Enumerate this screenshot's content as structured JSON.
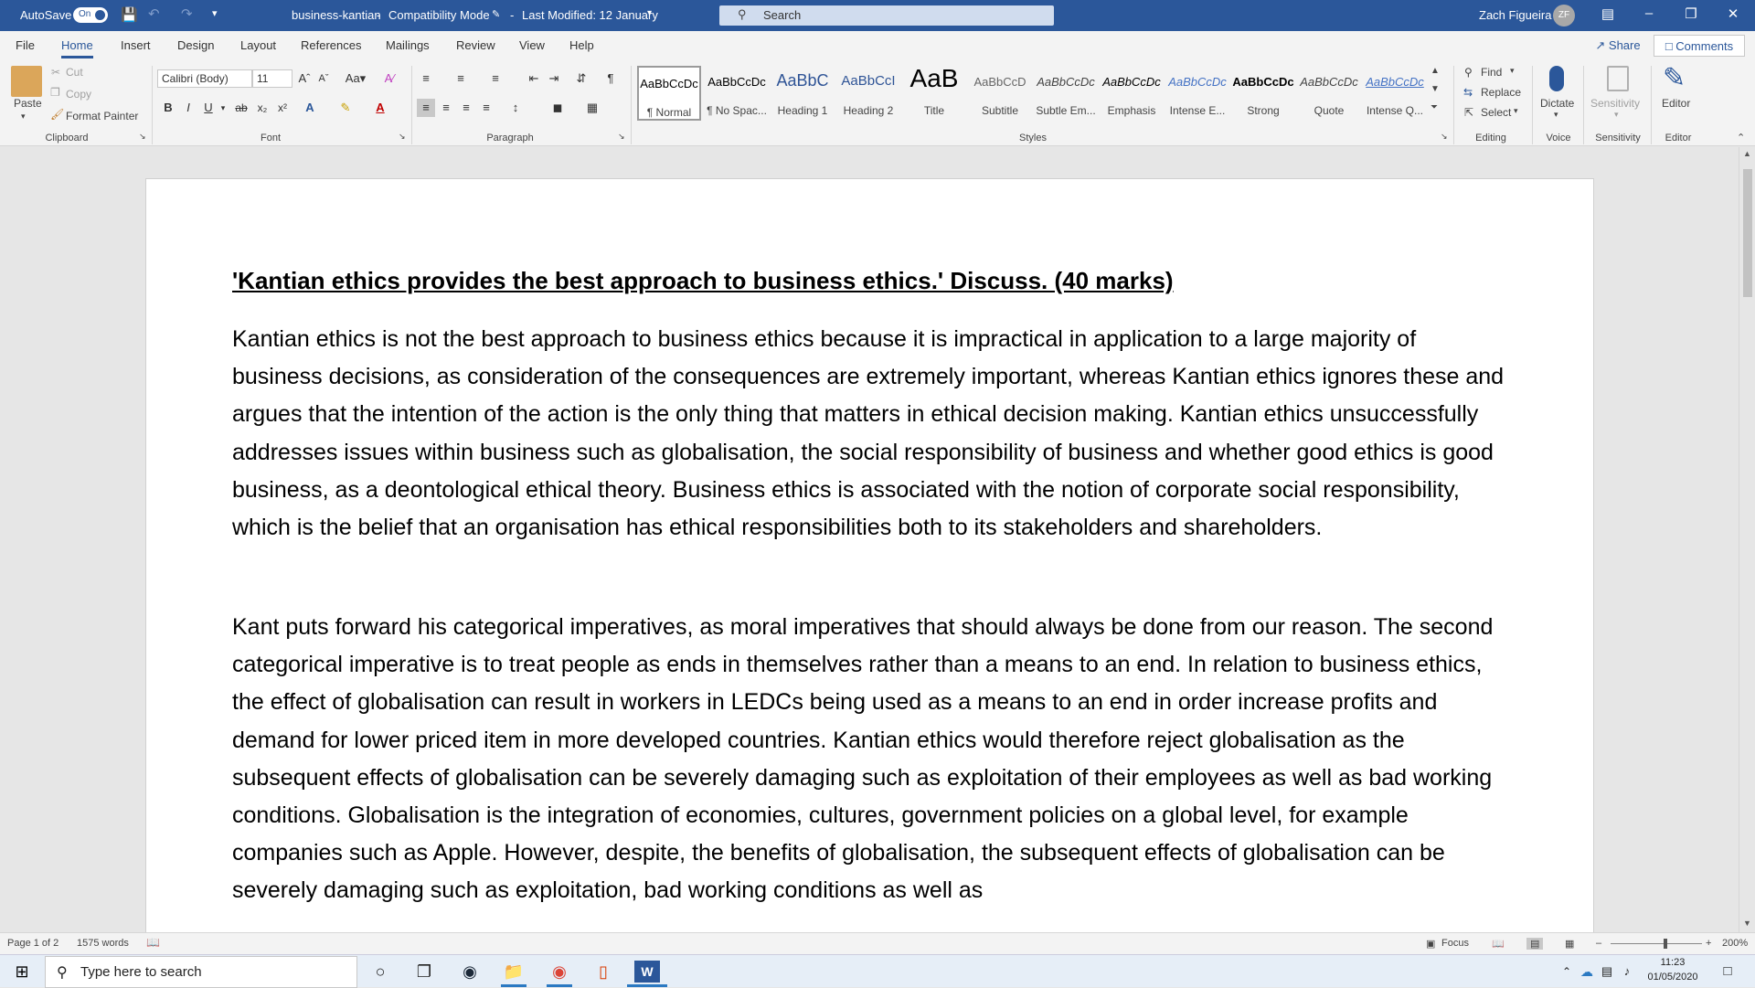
{
  "titlebar": {
    "autosave_label": "AutoSave",
    "autosave_state": "On",
    "doc_name": "business-kantian",
    "separator": "-",
    "mode": "Compatibility Mode",
    "separator2": "-",
    "last_modified": "Last Modified: 12 January",
    "search_placeholder": "Search",
    "user_name": "Zach Figueira",
    "user_initials": "ZF"
  },
  "tabs": [
    "File",
    "Home",
    "Insert",
    "Design",
    "Layout",
    "References",
    "Mailings",
    "Review",
    "View",
    "Help"
  ],
  "share_label": "Share",
  "comments_label": "Comments",
  "clipboard": {
    "paste": "Paste",
    "cut": "Cut",
    "copy": "Copy",
    "format_painter": "Format Painter",
    "group": "Clipboard"
  },
  "font": {
    "name": "Calibri (Body)",
    "size": "11",
    "group": "Font"
  },
  "paragraph": {
    "group": "Paragraph"
  },
  "styles": {
    "group": "Styles",
    "items": [
      {
        "preview": "AaBbCcDc",
        "name": "¶ Normal"
      },
      {
        "preview": "AaBbCcDc",
        "name": "¶ No Spac..."
      },
      {
        "preview": "AaBbC",
        "name": "Heading 1"
      },
      {
        "preview": "AaBbCcI",
        "name": "Heading 2"
      },
      {
        "preview": "AaB",
        "name": "Title"
      },
      {
        "preview": "AaBbCcD",
        "name": "Subtitle"
      },
      {
        "preview": "AaBbCcDc",
        "name": "Subtle Em..."
      },
      {
        "preview": "AaBbCcDc",
        "name": "Emphasis"
      },
      {
        "preview": "AaBbCcDc",
        "name": "Intense E..."
      },
      {
        "preview": "AaBbCcDc",
        "name": "Strong"
      },
      {
        "preview": "AaBbCcDc",
        "name": "Quote"
      },
      {
        "preview": "AaBbCcDc",
        "name": "Intense Q..."
      }
    ]
  },
  "editing": {
    "find": "Find",
    "replace": "Replace",
    "select": "Select",
    "group": "Editing"
  },
  "voice": {
    "dictate": "Dictate",
    "group": "Voice"
  },
  "sensitivity": {
    "label": "Sensitivity",
    "group": "Sensitivity"
  },
  "editor": {
    "label": "Editor",
    "group": "Editor"
  },
  "document": {
    "title": "'Kantian ethics provides the best approach to business ethics.' Discuss. (40 marks)",
    "paragraphs": [
      "Kantian ethics is not the best approach to business ethics because it is impractical in application to a large majority of business decisions, as consideration of the consequences are extremely important, whereas Kantian ethics ignores these and argues that the intention of the action is the only thing that matters in ethical decision making. Kantian ethics unsuccessfully addresses issues within business such as globalisation, the social responsibility of business and whether good ethics is good business, as a deontological ethical theory. Business ethics is associated with the notion of corporate social responsibility, which is the belief that an organisation has ethical responsibilities both to its stakeholders and shareholders.",
      "Kant puts forward his categorical imperatives, as moral imperatives that should always be done from our reason. The second categorical imperative is to treat people as ends in themselves rather than a means to an end. In relation to business ethics, the effect of globalisation can result in workers in LEDCs being used as a means to an end in order increase profits and demand for lower priced item in more developed countries. Kantian ethics would therefore reject globalisation as the subsequent effects of globalisation can be severely damaging such as exploitation of their employees as well as bad working conditions. Globalisation is the integration of economies, cultures, government policies on a global level, for example companies such as Apple. However, despite, the benefits of globalisation, the subsequent effects of globalisation can be severely damaging such as exploitation, bad working conditions as well as"
    ]
  },
  "status": {
    "page": "Page 1 of 2",
    "words": "1575 words",
    "focus": "Focus",
    "zoom": "200%"
  },
  "taskbar": {
    "search_placeholder": "Type here to search",
    "time": "11:23",
    "date": "01/05/2020"
  }
}
